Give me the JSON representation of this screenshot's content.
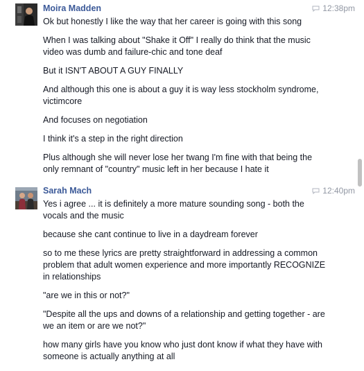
{
  "groups": [
    {
      "sender": "Moira Madden",
      "time": "12:38pm",
      "messages": [
        "Ok but honestly I like the way that her career is going with this song",
        "When I was talking about \"Shake it Off\" I really do think that the music video was dumb and failure-chic and tone deaf",
        "But it ISN'T ABOUT A GUY FINALLY",
        "And although this one is about a guy it is way less stockholm syndrome, victimcore",
        "And focuses on negotiation",
        "I think it's a step in the right direction",
        "Plus although she will never lose her twang I'm fine with that being the only remnant of \"country\" music left in her because I hate it"
      ]
    },
    {
      "sender": "Sarah Mach",
      "time": "12:40pm",
      "messages": [
        "Yes i agree ... it is definitely a more mature sounding song - both the vocals and the music",
        "because she cant continue to live in a daydream forever",
        "so to me these lyrics are pretty straightforward in addressing a common problem that adult women experience and more importantly RECOGNIZE in relationships",
        "\"are we in this or not?\"",
        "\"Despite all the ups and downs of a relationship and getting together - are we an item or are we not?\"",
        "how many girls have you know who just dont know if what they have with someone is actually anything at all"
      ]
    }
  ],
  "icons": {
    "message_time": "chat-bubble-icon"
  },
  "colors": {
    "sender_name": "#3b5998",
    "timestamp": "#9197a3",
    "text": "#141823"
  }
}
